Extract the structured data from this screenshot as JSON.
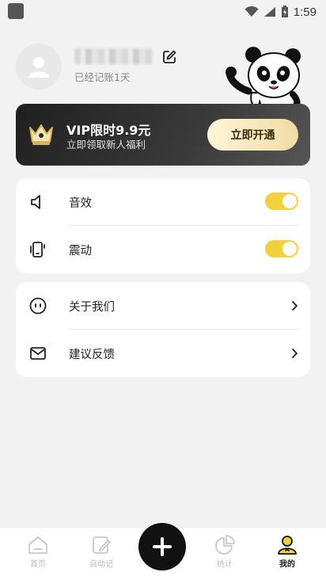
{
  "status_bar": {
    "time": "1:59"
  },
  "profile": {
    "days_text": "已经记账1天"
  },
  "vip": {
    "title": "VIP限时9.9元",
    "subtitle": "立即领取新人福利",
    "button_label": "立即开通"
  },
  "settings": {
    "sound_label": "音效",
    "sound_enabled": true,
    "vibration_label": "震动",
    "vibration_enabled": true
  },
  "links": {
    "about_label": "关于我们",
    "feedback_label": "建议反馈"
  },
  "bottom_nav": {
    "home_label": "首页",
    "auto_label": "自动记",
    "stats_label": "统计",
    "mine_label": "我的",
    "active": "mine"
  },
  "colors": {
    "accent": "#f2d13a",
    "vip_bg": "#2b2b2b",
    "fab_bg": "#111111"
  }
}
